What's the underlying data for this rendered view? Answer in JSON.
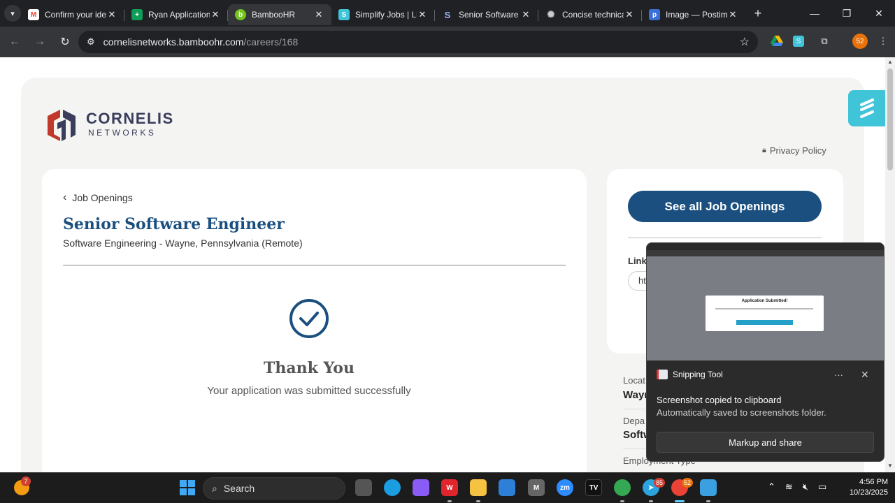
{
  "browser": {
    "tabs": [
      {
        "title": "Confirm your ide",
        "favicon": "gmail-icon",
        "color": "#ea4335"
      },
      {
        "title": "Ryan Application",
        "favicon": "sheets-icon",
        "color": "#0f9d58"
      },
      {
        "title": "BambooHR",
        "favicon": "bamboohr-icon",
        "color": "#73c41d",
        "active": true
      },
      {
        "title": "Simplify Jobs | Li",
        "favicon": "simplify-icon",
        "color": "#40c4d8"
      },
      {
        "title": "Senior Software",
        "favicon": "s-logo-icon",
        "color": "#ffffff"
      },
      {
        "title": "Concise technica",
        "favicon": "openai-icon",
        "color": "#cccccc"
      },
      {
        "title": "Image — Postim",
        "favicon": "postimg-icon",
        "color": "#3a6fd8"
      }
    ],
    "url_host": "cornelisnetworks.bamboohr.com",
    "url_path": "/careers/168",
    "profile_badge": "52"
  },
  "page": {
    "logo_word": "CORNELIS",
    "logo_sub": "NETWORKS",
    "privacy_label": "Privacy Policy",
    "back_label": "Job Openings",
    "job_title": "Senior Software Engineer",
    "job_subtitle": "Software Engineering - Wayne, Pennsylvania (Remote)",
    "thank_you": "Thank You",
    "submitted_msg": "Your application was submitted successfully",
    "see_all_label": "See all Job Openings",
    "linkedin_label": "Link",
    "linkedin_value": "ht",
    "location_label": "Locat",
    "location_value": "Wayn",
    "department_label": "Depa",
    "department_value": "Softw",
    "employment_label": "Employment Type",
    "accent": "#1a4f80"
  },
  "notification": {
    "app_name": "Snipping Tool",
    "more_label": "···",
    "title": "Screenshot copied to clipboard",
    "body": "Automatically saved to screenshots folder.",
    "action_label": "Markup and share",
    "thumb_dialog_title": "Application Submitted!"
  },
  "taskbar": {
    "weather_badge": "7",
    "search_label": "Search",
    "telegram_badge": "85",
    "chrome_badge": "52",
    "time": "4:56 PM",
    "date": "10/23/2025"
  }
}
